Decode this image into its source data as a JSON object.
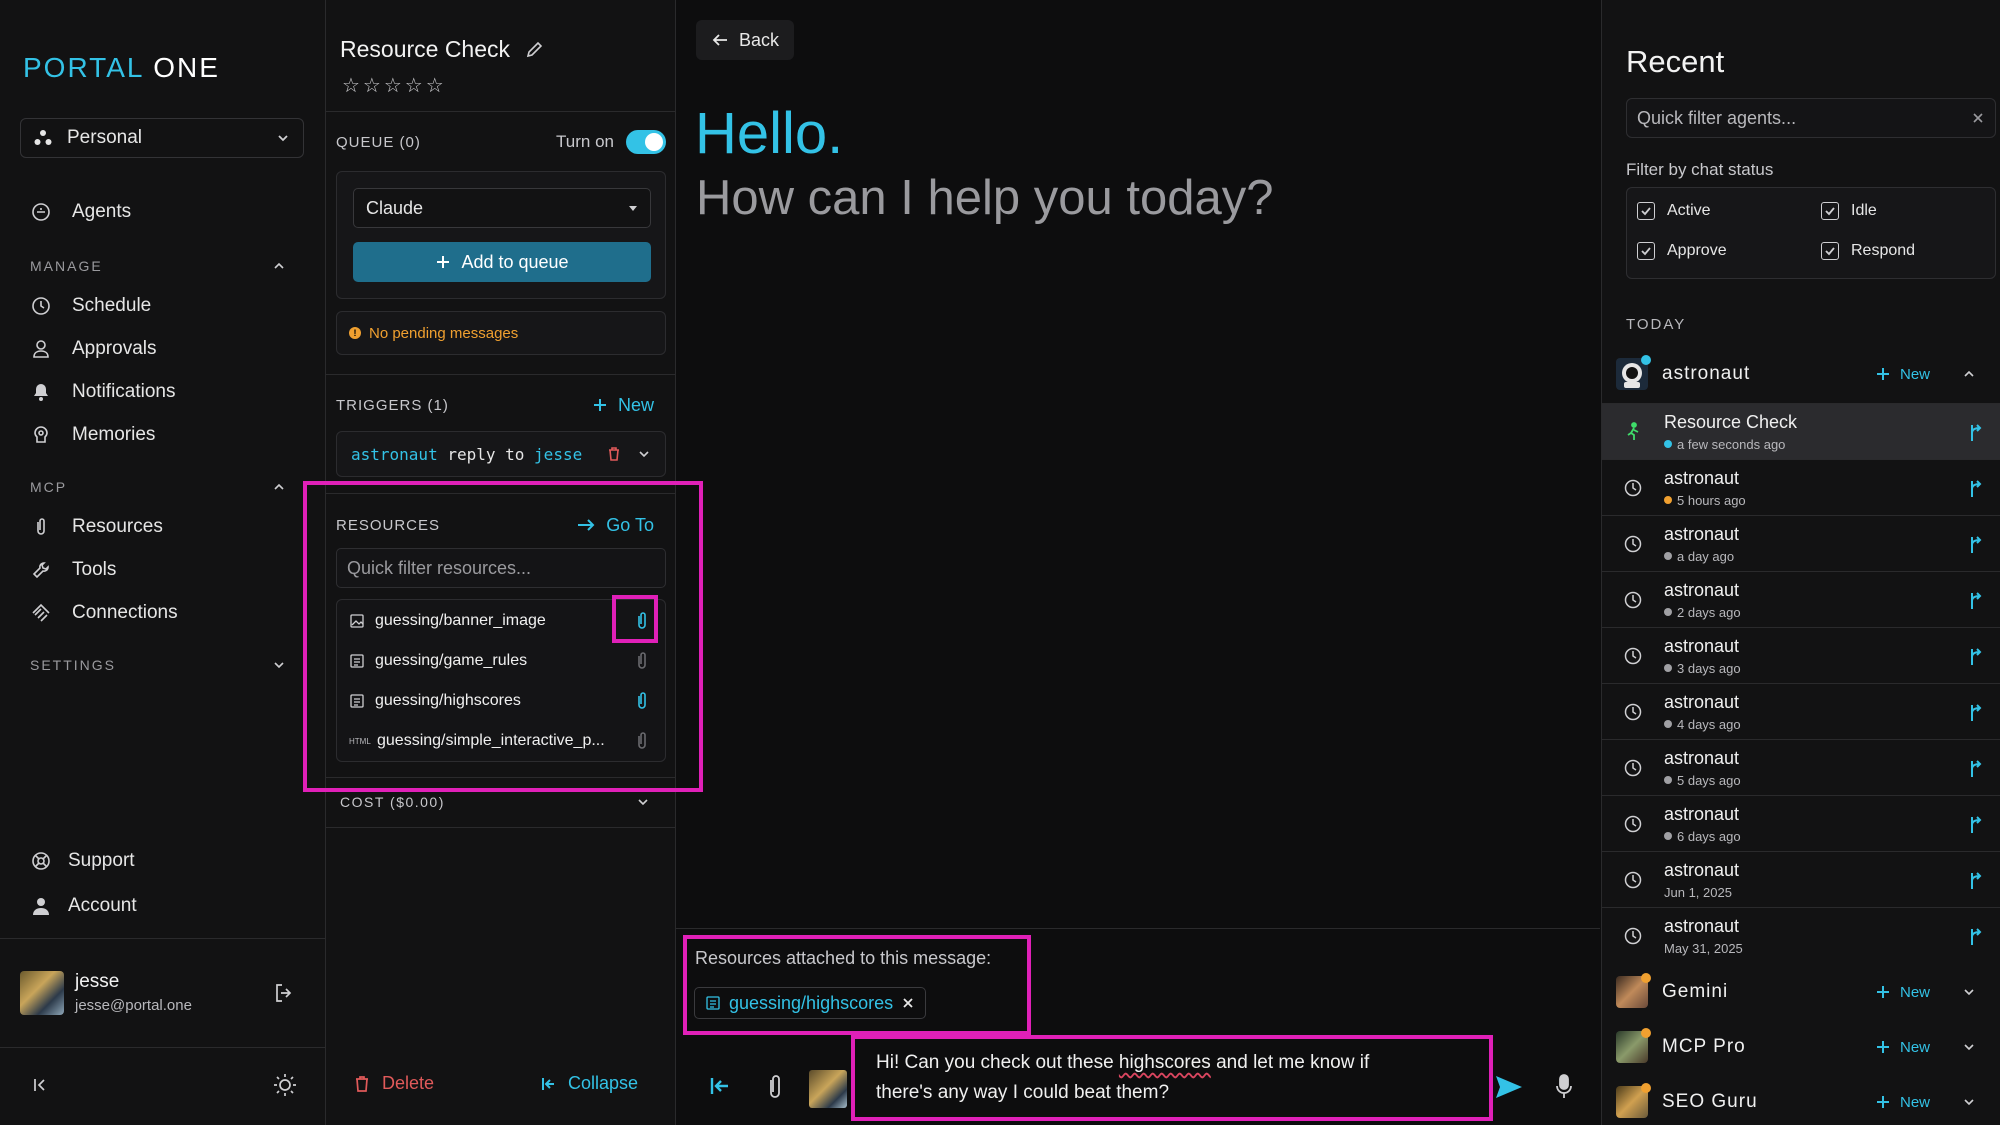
{
  "nav": {
    "logo_a": "PORTAL",
    "logo_b": "ONE",
    "workspace": "Personal",
    "agents": "Agents",
    "manage_label": "MANAGE",
    "schedule": "Schedule",
    "approvals": "Approvals",
    "notifications": "Notifications",
    "memories": "Memories",
    "mcp_label": "MCP",
    "resources": "Resources",
    "tools": "Tools",
    "connections": "Connections",
    "settings_label": "SETTINGS",
    "support": "Support",
    "account": "Account",
    "user_name": "jesse",
    "user_email": "jesse@portal.one"
  },
  "agent": {
    "title": "Resource Check",
    "stars": "☆☆☆☆☆",
    "queue_label": "QUEUE (0)",
    "turn_on": "Turn on",
    "model": "Claude",
    "add_to_queue": "Add to queue",
    "no_pending": "No pending messages",
    "triggers_label": "TRIGGERS (1)",
    "new_label": "New",
    "trigger_agent": "astronaut",
    "trigger_verb": "reply to",
    "trigger_target": "jesse",
    "resources_label": "RESOURCES",
    "goto": "Go To",
    "res_filter_placeholder": "Quick filter resources...",
    "resources": [
      "guessing/banner_image",
      "guessing/game_rules",
      "guessing/highscores",
      "guessing/simple_interactive_p..."
    ],
    "html_tag": "HTML",
    "cost_label": "COST ($0.00)",
    "delete": "Delete",
    "collapse": "Collapse"
  },
  "chat": {
    "back": "Back",
    "hello": "Hello.",
    "help": "How can I help you today?",
    "attached_label": "Resources attached to this message:",
    "attached_chip": "guessing/highscores",
    "msg_a": "Hi! Can you check out these ",
    "msg_b": "highscores",
    "msg_c": " and let me know if",
    "msg_d": "there's any way I could beat them?"
  },
  "recent": {
    "title": "Recent",
    "filter_placeholder": "Quick filter agents...",
    "status_label": "Filter by chat status",
    "statuses": [
      "Active",
      "Idle",
      "Approve",
      "Respond"
    ],
    "today": "TODAY",
    "new_label": "New",
    "groups": [
      "astronaut",
      "Gemini",
      "MCP Pro",
      "SEO Guru"
    ],
    "chats": [
      {
        "name": "Resource Check",
        "time": "a few seconds ago"
      },
      {
        "name": "astronaut",
        "time": "5 hours ago"
      },
      {
        "name": "astronaut",
        "time": "a day ago"
      },
      {
        "name": "astronaut",
        "time": "2 days ago"
      },
      {
        "name": "astronaut",
        "time": "3 days ago"
      },
      {
        "name": "astronaut",
        "time": "4 days ago"
      },
      {
        "name": "astronaut",
        "time": "5 days ago"
      },
      {
        "name": "astronaut",
        "time": "6 days ago"
      },
      {
        "name": "astronaut",
        "time": "Jun 1, 2025"
      },
      {
        "name": "astronaut",
        "time": "May 31, 2025"
      }
    ]
  },
  "colors": {
    "accent": "#33c2e6",
    "highlight": "#e020b8",
    "warning": "#f0a030",
    "primary_button": "#1f6e8c"
  }
}
